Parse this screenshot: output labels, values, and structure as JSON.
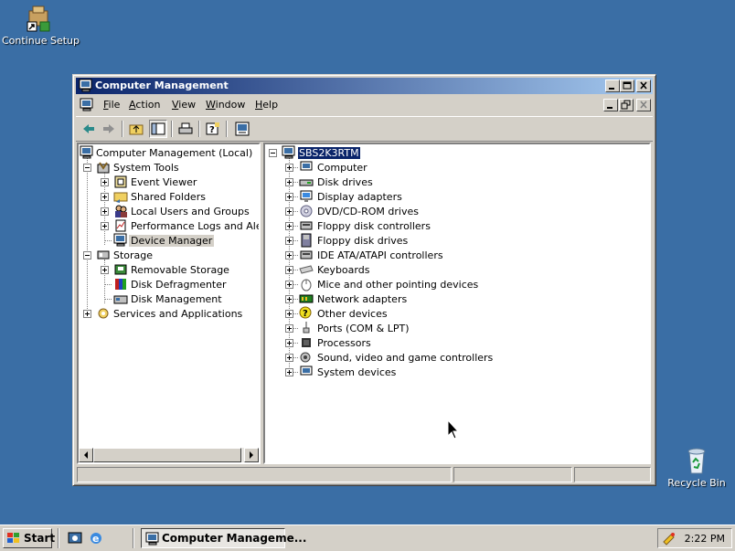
{
  "desktop": {
    "icons": [
      {
        "label": "Continue Setup",
        "icon": "setup-shortcut-icon"
      },
      {
        "label": "Recycle Bin",
        "icon": "recycle-bin-icon"
      }
    ]
  },
  "window": {
    "title": "Computer Management",
    "menus": [
      {
        "label": "File",
        "accel": "F"
      },
      {
        "label": "Action",
        "accel": "A"
      },
      {
        "label": "View",
        "accel": "V"
      },
      {
        "label": "Window",
        "accel": "W"
      },
      {
        "label": "Help",
        "accel": "H"
      }
    ],
    "toolbar": [
      "back-icon",
      "forward-icon",
      "up-folder-icon",
      "show-hide-tree-icon",
      "print-icon",
      "help-icon",
      "properties-icon"
    ]
  },
  "tree": {
    "root": "Computer Management (Local)",
    "system_tools": "System Tools",
    "event_viewer": "Event Viewer",
    "shared_folders": "Shared Folders",
    "local_users": "Local Users and Groups",
    "perf_logs": "Performance Logs and Alerts",
    "device_manager": "Device Manager",
    "storage": "Storage",
    "removable_storage": "Removable Storage",
    "disk_defrag": "Disk Defragmenter",
    "disk_mgmt": "Disk Management",
    "services_apps": "Services and Applications"
  },
  "devices": {
    "computer_name": "SBS2K3RTM",
    "categories": [
      "Computer",
      "Disk drives",
      "Display adapters",
      "DVD/CD-ROM drives",
      "Floppy disk controllers",
      "Floppy disk drives",
      "IDE ATA/ATAPI controllers",
      "Keyboards",
      "Mice and other pointing devices",
      "Network adapters",
      "Other devices",
      "Ports (COM & LPT)",
      "Processors",
      "Sound, video and game controllers",
      "System devices"
    ]
  },
  "taskbar": {
    "start_label": "Start",
    "task_label": "Computer Manageme...",
    "clock": "2:22 PM"
  }
}
